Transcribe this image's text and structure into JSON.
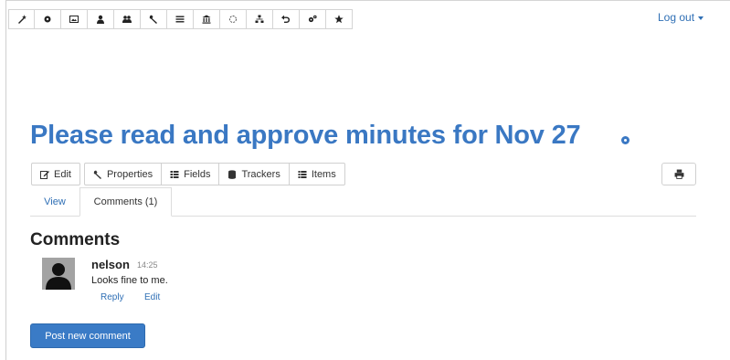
{
  "toolbar": {
    "buttons": [
      {
        "icon": "wand-icon"
      },
      {
        "icon": "gear-icon"
      },
      {
        "icon": "image-icon"
      },
      {
        "icon": "user-icon"
      },
      {
        "icon": "users-icon"
      },
      {
        "icon": "wrench-icon"
      },
      {
        "icon": "list-icon"
      },
      {
        "icon": "bank-icon"
      },
      {
        "icon": "spinner-icon"
      },
      {
        "icon": "sitemap-icon"
      },
      {
        "icon": "undo-icon"
      },
      {
        "icon": "cogs-icon"
      },
      {
        "icon": "star-icon"
      }
    ]
  },
  "header": {
    "logout_label": "Log out"
  },
  "page": {
    "title": "Please read and approve minutes for Nov 27"
  },
  "actions": {
    "edit_label": "Edit",
    "properties_label": "Properties",
    "fields_label": "Fields",
    "trackers_label": "Trackers",
    "items_label": "Items"
  },
  "tabs": {
    "view_label": "View",
    "comments_label": "Comments (1)"
  },
  "comments": {
    "heading": "Comments",
    "items": [
      {
        "author": "nelson",
        "time": "14:25",
        "text": "Looks fine to me.",
        "reply_label": "Reply",
        "edit_label": "Edit"
      }
    ],
    "post_label": "Post new comment"
  },
  "colors": {
    "accent": "#3a78c3",
    "link": "#2f6fb5",
    "button": "#3a7bc6"
  }
}
